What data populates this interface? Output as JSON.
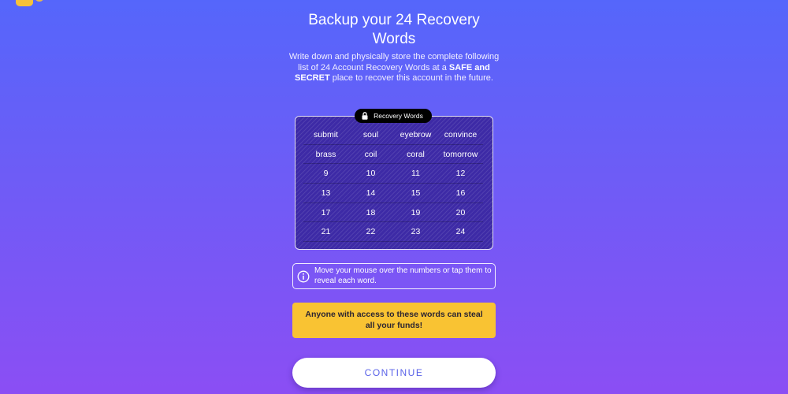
{
  "header": {
    "title_line1": "Backup your 24 Recovery",
    "title_line2": "Words"
  },
  "description": {
    "part1": "Write down and physically store the complete following list of 24 Account Recovery Words at a ",
    "emphasis": "SAFE and SECRET",
    "part2": " place to recover this account in the future."
  },
  "recovery": {
    "badge_label": "Recovery Words",
    "badge_icon": "lock-icon",
    "words": [
      "submit",
      "soul",
      "eyebrow",
      "convince",
      "brass",
      "coil",
      "coral",
      "tomorrow",
      "9",
      "10",
      "11",
      "12",
      "13",
      "14",
      "15",
      "16",
      "17",
      "18",
      "19",
      "20",
      "21",
      "22",
      "23",
      "24"
    ]
  },
  "info": {
    "icon": "info-icon",
    "text": "Move your mouse over the numbers or tap them to reveal each word."
  },
  "warning": {
    "text": "Anyone with access to these words can steal all your funds!"
  },
  "actions": {
    "continue_label": "CONTINUE"
  },
  "colors": {
    "gradient_top": "#5566fb",
    "gradient_bottom": "#8b4ef4",
    "words_panel": "#3d2aa6",
    "warning": "#f9c333",
    "continue_text": "#5a63e8"
  }
}
